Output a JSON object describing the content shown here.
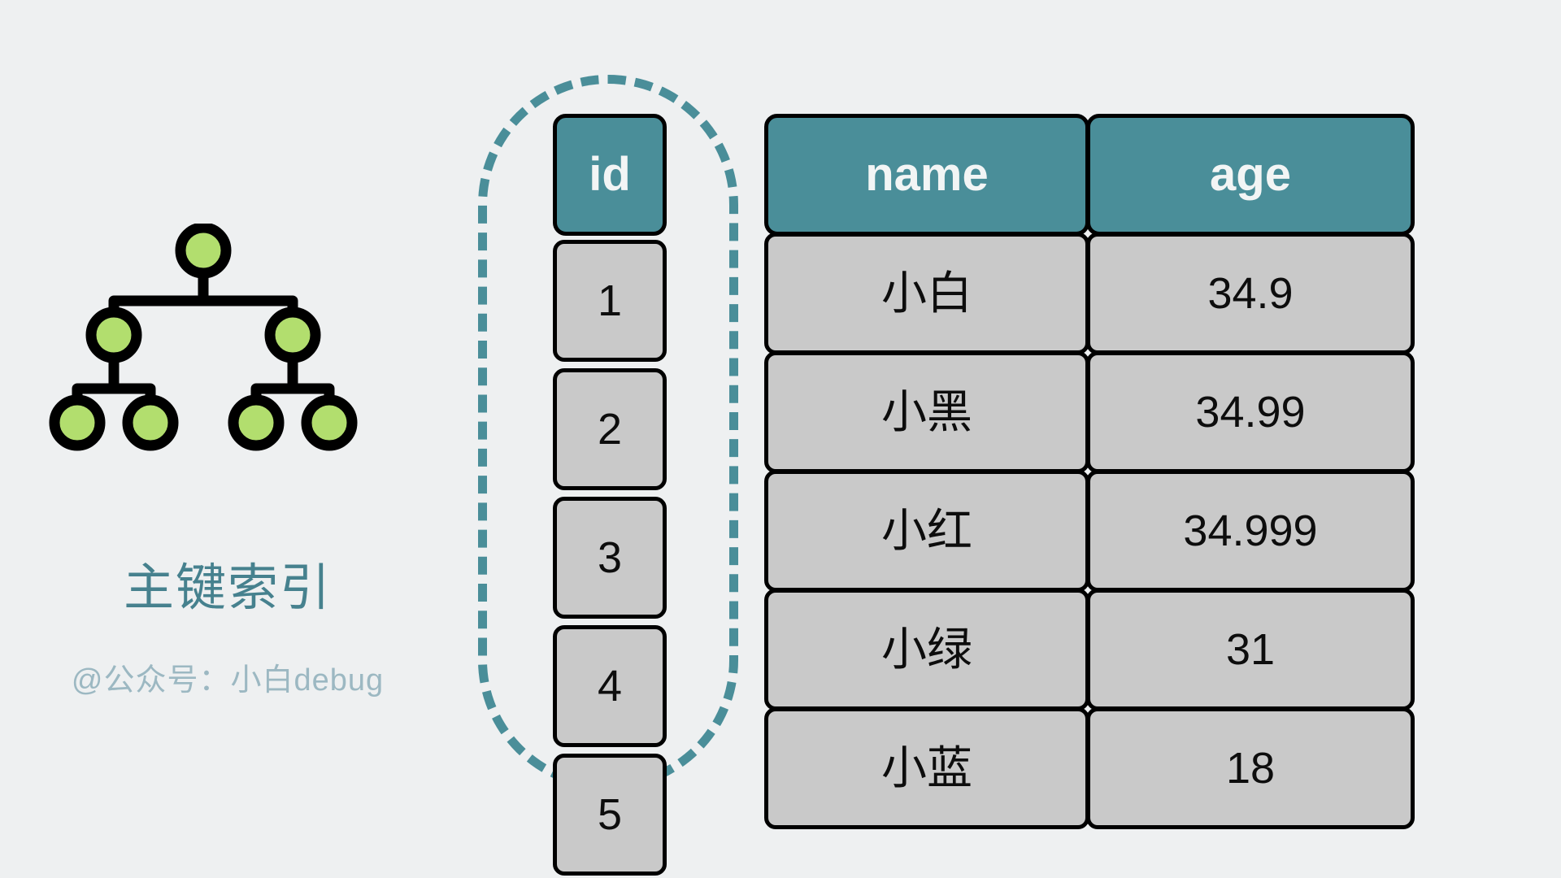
{
  "index_panel": {
    "title": "主键索引",
    "watermark": "@公众号：小白debug",
    "tree": {
      "node_fill": "#b2de6e",
      "node_stroke": "#000000",
      "levels": 3,
      "nodes_per_level": [
        1,
        2,
        4
      ]
    }
  },
  "colors": {
    "background": "#eef0f1",
    "header_teal": "#4a8e99",
    "cell_gray": "#c9c9c9",
    "cell_border": "#000000",
    "title_teal": "#46818e",
    "watermark_gray": "#9cb8c2",
    "dashed_highlight": "#4a8e99",
    "node_green": "#b2de6e"
  },
  "id_column": {
    "header": "id",
    "values": [
      "1",
      "2",
      "3",
      "4",
      "5"
    ],
    "highlighted": true
  },
  "data_table": {
    "headers": [
      "name",
      "age"
    ],
    "rows": [
      {
        "name": "小白",
        "age": "34.9"
      },
      {
        "name": "小黑",
        "age": "34.99"
      },
      {
        "name": "小红",
        "age": "34.999"
      },
      {
        "name": "小绿",
        "age": "31"
      },
      {
        "name": "小蓝",
        "age": "18"
      }
    ]
  }
}
